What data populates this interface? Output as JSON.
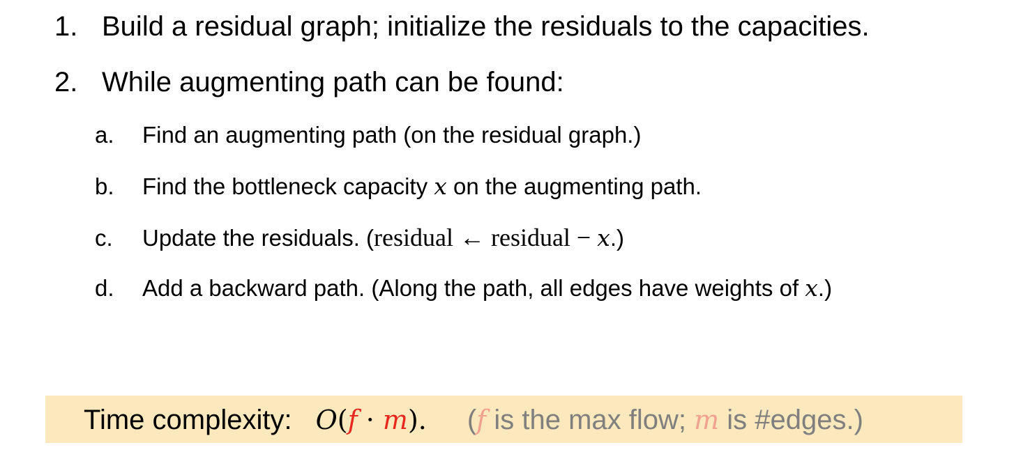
{
  "steps": [
    {
      "number": "1.",
      "text": "Build a residual graph; initialize the residuals to the capacities."
    },
    {
      "number": "2.",
      "text": "While augmenting path can be found:"
    }
  ],
  "substeps": [
    {
      "letter": "a.",
      "text": "Find an augmenting path (on the residual graph.)"
    },
    {
      "letter": "b.",
      "pre": "Find the bottleneck capacity ",
      "var": "x",
      "post": " on the augmenting path."
    },
    {
      "letter": "c.",
      "pre": "Update the residuals. (",
      "math": "residual ← residual − ",
      "var": "x",
      "post": ".)"
    },
    {
      "letter": "d.",
      "pre": "Add a backward path. (Along the path, all edges have weights of ",
      "var": "x",
      "post": ".)"
    }
  ],
  "complexity": {
    "label": "Time complexity:",
    "big_o": "O",
    "open_paren": "(",
    "f": "f",
    "dot": " · ",
    "m": "m",
    "close": ").",
    "note_open": "(",
    "note_f": "f",
    "note_mid": " is the max flow; ",
    "note_m": "m",
    "note_end": " is #edges.)"
  },
  "colors": {
    "highlight_box": "#fce8bd",
    "formula_accent": "#e8281e",
    "note_text": "#7f7f7f",
    "note_accent": "#f2a090"
  }
}
